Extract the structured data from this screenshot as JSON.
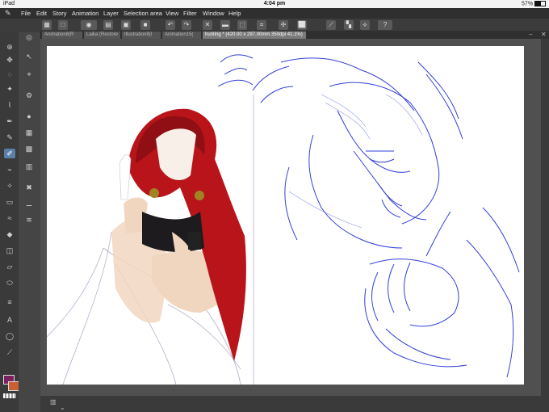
{
  "status_bar": {
    "device": "iPad",
    "time": "4:04 pm",
    "battery": "57%",
    "battery_level": 0.57
  },
  "menu": [
    "File",
    "Edit",
    "Story",
    "Animation",
    "Layer",
    "Selection area",
    "View",
    "Filter",
    "Window",
    "Help"
  ],
  "tabs": [
    {
      "label": "Animation8(R",
      "active": false
    },
    {
      "label": "Laika (Restore",
      "active": false
    },
    {
      "label": "Illustration8(I",
      "active": false
    },
    {
      "label": "Animation15(",
      "active": false
    },
    {
      "label": "hunting * (420.00 x 297.00mm 350dpi 41.1%)",
      "active": true
    }
  ],
  "colors": {
    "main": "#7b2160",
    "sub": "#c86034",
    "canvas_bg": "#505050",
    "ui_dark": "#2f2f2f",
    "selection": "#5b7fa8"
  },
  "icons": {
    "toolbar": [
      "new-icon",
      "open-icon",
      "save-icon",
      "undo-icon",
      "redo-icon",
      "transform-icon",
      "settings-icon",
      "help-icon"
    ],
    "tools": [
      "zoom-icon",
      "move-icon",
      "lasso-icon",
      "eyedropper-icon",
      "pen-icon",
      "brush-icon",
      "eraser-icon",
      "fill-icon",
      "gradient-icon",
      "shape-icon",
      "text-icon",
      "ruler-icon"
    ]
  }
}
